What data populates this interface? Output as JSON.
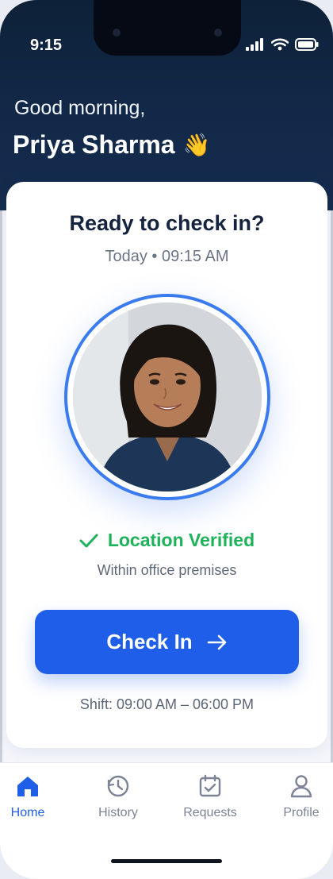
{
  "status_bar": {
    "time": "9:15"
  },
  "header": {
    "greeting": "Good morning,",
    "user_name": "Priya Sharma",
    "wave_emoji": "👋"
  },
  "card": {
    "title": "Ready to check in?",
    "subtitle": "Today • 09:15 AM",
    "location_status": "Location Verified",
    "location_detail": "Within office premises",
    "checkin_label": "Check In",
    "shift": "Shift: 09:00 AM – 06:00 PM"
  },
  "tabs": [
    {
      "label": "Home",
      "icon": "home-icon",
      "active": true
    },
    {
      "label": "History",
      "icon": "history-icon",
      "active": false
    },
    {
      "label": "Requests",
      "icon": "requests-icon",
      "active": false
    },
    {
      "label": "Profile",
      "icon": "profile-icon",
      "active": false
    }
  ],
  "colors": {
    "primary": "#1f5ee8",
    "success": "#1eb25b",
    "header_bg": "#13294a"
  }
}
